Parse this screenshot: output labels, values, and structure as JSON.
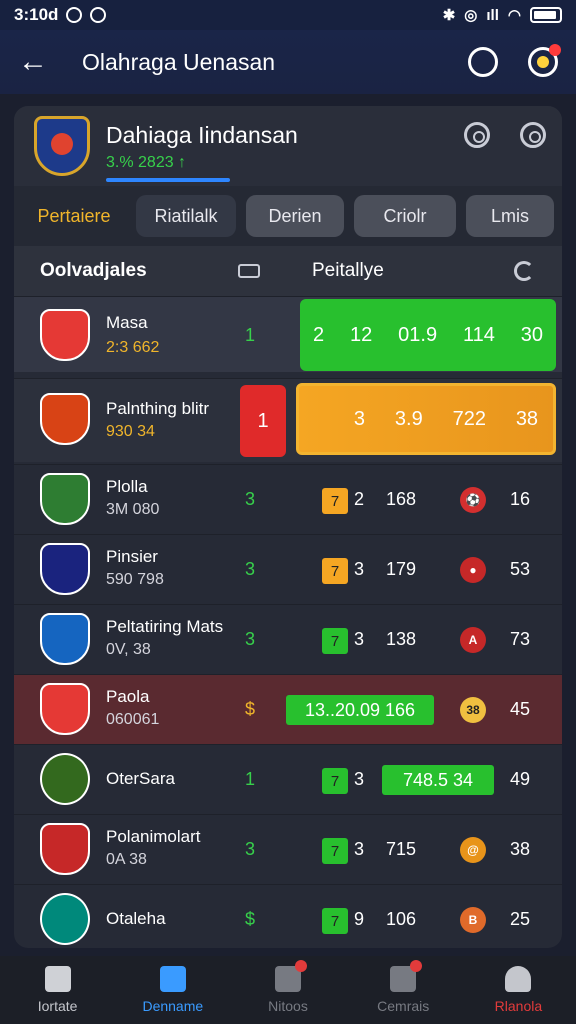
{
  "statusbar": {
    "time": "3:10d",
    "net": "ıll"
  },
  "appbar": {
    "title": "Olahraga Uenasan"
  },
  "league": {
    "name": "Dahiaga Iindansan",
    "sub": "3.% 2823 ↑"
  },
  "tabs": [
    "Pertaiere",
    "Riatilalk",
    "Derien",
    "Criolr",
    "Lmis"
  ],
  "table": {
    "club_col": "Oolvadjales",
    "perf_col": "Peitallye"
  },
  "rows": [
    {
      "name": "Masa",
      "score": "2:3 662",
      "pos": "1",
      "bar": [
        "2",
        "12",
        "01.9",
        "114",
        "30"
      ],
      "badge_color": "#e53935"
    },
    {
      "name": "Palnthing blitr",
      "score": "930 34",
      "red": "1",
      "bar": [
        "3",
        "3.9",
        "722",
        "38"
      ],
      "badge_color": "#d84315"
    },
    {
      "name": "Plolla",
      "score": "3M 080",
      "pos": "3",
      "chip": "7",
      "chip_color": "#f5a623",
      "a": "2",
      "b": "168",
      "c": "16",
      "ball_color": "#d32f2f",
      "ball_glyph": "⚽"
    },
    {
      "name": "Pinsier",
      "score": "590 798",
      "pos": "3",
      "chip": "7",
      "chip_color": "#f5a623",
      "a": "3",
      "b": "179",
      "c": "53",
      "ball_color": "#c62828",
      "ball_glyph": "●"
    },
    {
      "name": "Peltatiring Mats",
      "score": "0V, 38",
      "pos": "3",
      "chip": "7",
      "chip_color": "#28c02e",
      "a": "3",
      "b": "138",
      "c": "73",
      "ball_color": "#c62828",
      "ball_glyph": "A"
    },
    {
      "name": "Paola",
      "score": "060061",
      "pos": "$",
      "mid": "13..20.09 166",
      "ball_glyph": "38",
      "c": "45",
      "ball_color": "#f0c040"
    },
    {
      "name": "OterSara",
      "score": "",
      "pos": "1",
      "chip": "7",
      "chip_color": "#28c02e",
      "a": "3",
      "mid": "748.5 34",
      "c": "49"
    },
    {
      "name": "Polanimolart",
      "score": "0A 38",
      "pos": "3",
      "chip": "7",
      "chip_color": "#28c02e",
      "a": "3",
      "b": "715",
      "c": "38",
      "ball_color": "#e8941a",
      "ball_glyph": "@"
    },
    {
      "name": "Otaleha",
      "score": "",
      "pos": "$",
      "chip": "7",
      "chip_color": "#28c02e",
      "a": "9",
      "b": "106",
      "c": "25",
      "ball_color": "#e06a2a",
      "ball_glyph": "B"
    }
  ],
  "nav": [
    {
      "label": "Iortate",
      "icon": "home-icon"
    },
    {
      "label": "Denname",
      "icon": "home-active-icon"
    },
    {
      "label": "Nitoos",
      "icon": "news-icon"
    },
    {
      "label": "Cemrais",
      "icon": "chat-icon"
    },
    {
      "label": "Rlanola",
      "icon": "profile-icon"
    }
  ]
}
